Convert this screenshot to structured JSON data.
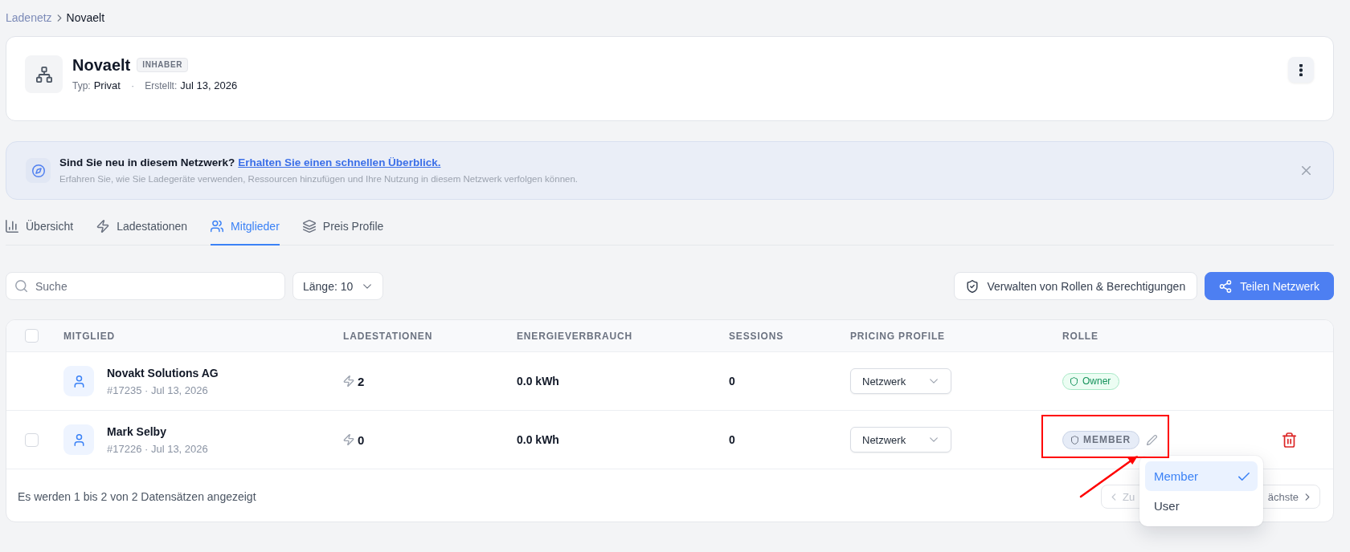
{
  "breadcrumb": [
    "Ladenetz",
    "Novaelt"
  ],
  "network": {
    "name": "Novaelt",
    "badge": "INHABER",
    "type_label": "Typ:",
    "type_value": "Privat",
    "separator": "·",
    "created_label": "Erstellt:",
    "created_value": "Jul 13, 2026"
  },
  "banner": {
    "title": "Sind Sie neu in diesem Netzwerk?",
    "link": "Erhalten Sie einen schnellen Überblick.",
    "text": "Erfahren Sie, wie Sie Ladegeräte verwenden, Ressourcen hinzufügen und Ihre Nutzung in diesem Netzwerk verfolgen können."
  },
  "tabs": [
    {
      "label": "Übersicht",
      "selected": false
    },
    {
      "label": "Ladestationen",
      "selected": false
    },
    {
      "label": "Mitglieder",
      "selected": true
    },
    {
      "label": "Preis Profile",
      "selected": false
    }
  ],
  "toolbar": {
    "search": {
      "placeholder": "Suche"
    },
    "length_select": "Länge: 10",
    "buttons": [
      {
        "label": "Verwalten von Rollen & Berechtigungen",
        "kind": "secondary"
      },
      {
        "label": "Teilen Netzwerk",
        "kind": "primary"
      }
    ]
  },
  "table": {
    "select_all": {
      "checked": false
    },
    "columns": [
      "MITGLIED",
      "LADESTATIONEN",
      "ENERGIEVERBRAUCH",
      "SESSIONS",
      "PRICING PROFILE",
      "ROLLE"
    ],
    "rows": [
      {
        "selectable": false,
        "name": "Novakt Solutions AG",
        "meta": "#17235 · Jul 13, 2026",
        "stations": "2",
        "energy": "0.0 kWh",
        "sessions": "0",
        "pricing_profile": "Netzwerk",
        "role": {
          "label": "Owner",
          "kind": "owner"
        },
        "editable": false,
        "deletable": false
      },
      {
        "selectable": true,
        "checked": false,
        "name": "Mark Selby",
        "meta": "#17226 · Jul 13, 2026",
        "stations": "0",
        "energy": "0.0 kWh",
        "sessions": "0",
        "pricing_profile": "Netzwerk",
        "role": {
          "label": "MEMBER",
          "kind": "member"
        },
        "editable": true,
        "deletable": true
      }
    ],
    "footer": "Es werden 1 bis 2 von 2 Datensätzen angezeigt"
  },
  "pagination": {
    "previous": {
      "label": "Zu",
      "disabled": true
    },
    "next": {
      "label": "ächste",
      "disabled": false
    }
  },
  "role_menu": {
    "options": [
      {
        "label": "Member",
        "selected": true
      },
      {
        "label": "User",
        "selected": false
      }
    ]
  }
}
